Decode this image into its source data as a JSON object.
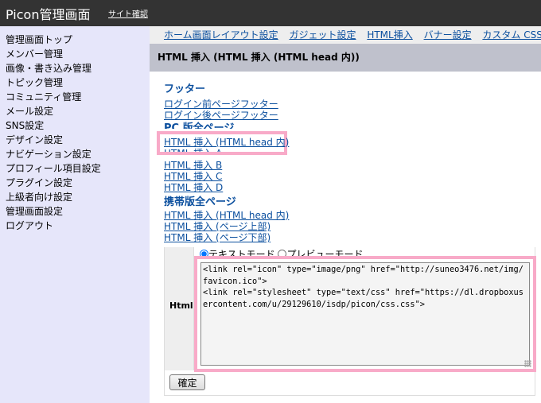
{
  "header": {
    "logo": "Picon管理画面",
    "site_link": "サイト確認"
  },
  "sidebar": {
    "items": [
      "管理画面トップ",
      "メンバー管理",
      "画像・書き込み管理",
      "トピック管理",
      "コミュニティ管理",
      "メール設定",
      "SNS設定",
      "デザイン設定",
      "ナビゲーション設定",
      "プロフィール項目設定",
      "プラグイン設定",
      "上級者向け設定",
      "管理画面設定",
      "ログアウト"
    ]
  },
  "topnav": {
    "items": [
      "ホーム画面レイアウト設定",
      "ガジェット設定",
      "HTML挿入",
      "バナー設定",
      "カスタム CSS 設定"
    ]
  },
  "page_title": "HTML 挿入 (HTML 挿入 (HTML head 内))",
  "sections": {
    "footer": {
      "title": "フッター",
      "links": [
        "ログイン前ページフッター",
        "ログイン後ページフッター"
      ]
    },
    "pc": {
      "title": "PC 版全ページ",
      "links": [
        "HTML 挿入 (HTML head 内)",
        "HTML 挿入 A",
        "HTML 挿入 B",
        "HTML 挿入 C",
        "HTML 挿入 D"
      ]
    },
    "mobile": {
      "title": "携帯版全ページ",
      "links": [
        "HTML 挿入 (HTML head 内)",
        "HTML 挿入 (ページ上部)",
        "HTML 挿入 (ページ下部)"
      ]
    }
  },
  "form": {
    "label": "Html",
    "mode_text": "テキストモード",
    "mode_preview": "プレビューモード",
    "value": "<link rel=\"icon\" type=\"image/png\" href=\"http://suneo3476.net/img/favicon.ico\">\n<link rel=\"stylesheet\" type=\"text/css\" href=\"https://dl.dropboxusercontent.com/u/29129610/isdp/picon/css.css\">",
    "submit": "確定"
  },
  "colors": {
    "highlight": "#f8aac8",
    "link": "#0b4f9e",
    "header_bg": "#333333",
    "sidebar_bg": "#e6e6fa"
  }
}
